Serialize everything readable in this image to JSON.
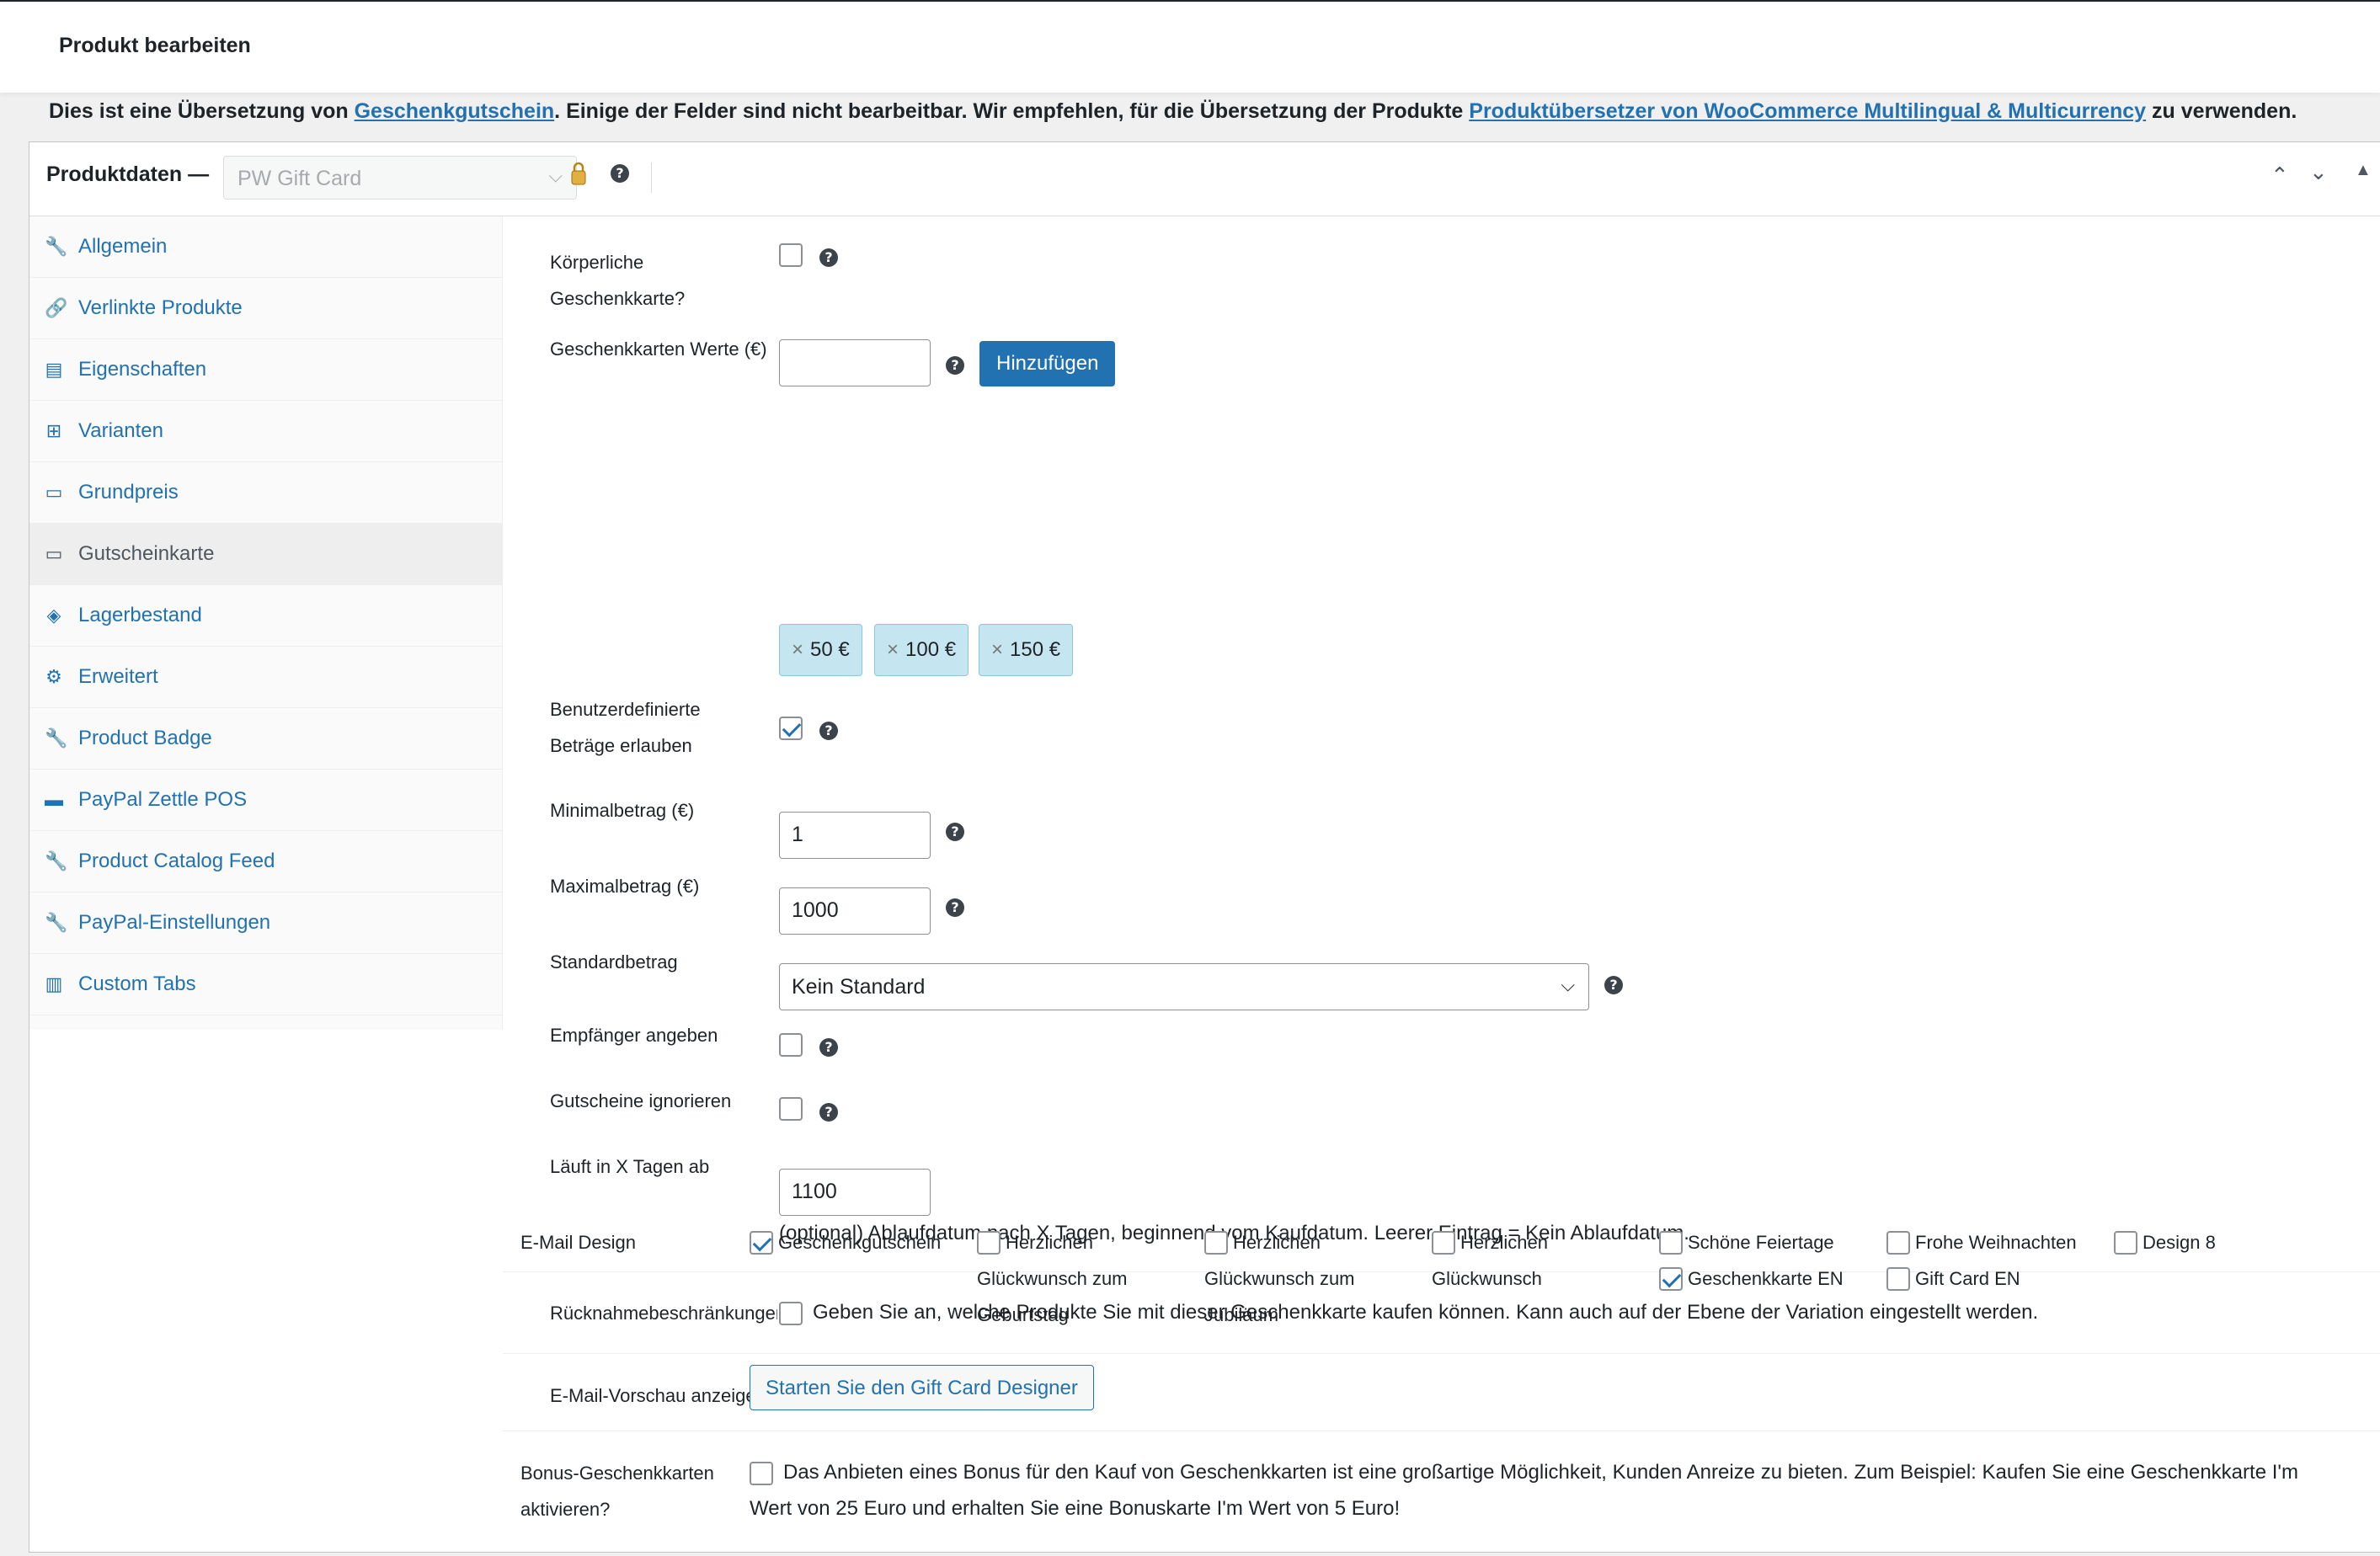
{
  "header": {
    "title": "Produkt bearbeiten"
  },
  "notice": {
    "text1": "Dies ist eine Übersetzung von ",
    "link1": "Geschenkgutschein",
    "text2": ". Einige der Felder sind nicht bearbeitbar. Wir empfehlen, für die Übersetzung der Produkte ",
    "link2": "Produktübersetzer von WooCommerce Multilingual & Multicurrency",
    "text3": " zu verwenden."
  },
  "product_data": {
    "label": "Produktdaten —",
    "type_value": "PW Gift Card"
  },
  "tabs": [
    {
      "label": "Allgemein",
      "icon": "wrench-icon"
    },
    {
      "label": "Verlinkte Produkte",
      "icon": "link-icon"
    },
    {
      "label": "Eigenschaften",
      "icon": "list-icon"
    },
    {
      "label": "Varianten",
      "icon": "grid-icon"
    },
    {
      "label": "Grundpreis",
      "icon": "card-icon"
    },
    {
      "label": "Gutscheinkarte",
      "icon": "card-icon"
    },
    {
      "label": "Lagerbestand",
      "icon": "tag-icon"
    },
    {
      "label": "Erweitert",
      "icon": "gear-icon"
    },
    {
      "label": "Product Badge",
      "icon": "wrench-icon"
    },
    {
      "label": "PayPal Zettle POS",
      "icon": "pos-icon"
    },
    {
      "label": "Product Catalog Feed",
      "icon": "wrench-icon"
    },
    {
      "label": "PayPal-Einstellungen",
      "icon": "wrench-icon"
    },
    {
      "label": "Custom Tabs",
      "icon": "tabs-icon"
    }
  ],
  "form": {
    "physical_label1": "Körperliche",
    "physical_label2": "Geschenkkarte?",
    "values_label": "Geschenkkarten Werte (€)",
    "values_input": "",
    "add_button": "Hinzufügen",
    "chips": [
      "50 €",
      "100 €",
      "150 €"
    ],
    "custom_label1": "Benutzerdefinierte",
    "custom_label2": "Beträge erlauben",
    "min_label": "Minimalbetrag (€)",
    "min_value": "1",
    "max_label": "Maximalbetrag (€)",
    "max_value": "1000",
    "default_label": "Standardbetrag",
    "default_value": "Kein Standard",
    "recipient_label": "Empfänger angeben",
    "ignore_label": "Gutscheine ignorieren",
    "expiry_label": "Läuft in X Tagen ab",
    "expiry_value": "1100",
    "expiry_desc": "(optional) Ablaufdatum nach X Tagen, beginnend vom Kaufdatum. Leerer Eintrag = Kein Ablaufdatum.",
    "restrict_label": "Rücknahmebeschränkungen",
    "restrict_desc": "Geben Sie an, welche Produkte Sie mit dieser Geschenkkarte kaufen können. Kann auch auf der Ebene der Variation eingestellt werden.",
    "preview_label": "E-Mail-Vorschau anzeigen",
    "design_label": "E-Mail Design",
    "designs": {
      "d1": "Geschenkgutschein",
      "d2a": "Herzlichen",
      "d2b": "Glückwunsch zum",
      "d2c": "Geburtstag",
      "d3a": "Herzlichen",
      "d3b": "Glückwunsch zum",
      "d3c": "Jubiläum",
      "d4a": "Herzlichen",
      "d4b": "Glückwunsch",
      "d5": "Schöne Feiertage",
      "d6": "Frohe Weihnachten",
      "d7": "Design 8",
      "d8": "Geschenkkarte EN",
      "d9": "Gift Card EN"
    },
    "designer_button": "Starten Sie den Gift Card Designer",
    "bonus_label1": "Bonus-Geschenkkarten",
    "bonus_label2": "aktivieren?",
    "bonus_desc1": "Das Anbieten eines Bonus für den Kauf von Geschenkkarten ist eine großartige Möglichkeit, Kunden Anreize zu bieten. Zum Beispiel: Kaufen Sie eine Geschenkkarte I'm",
    "bonus_desc2": "Wert von 25 Euro und erhalten Sie eine Bonuskarte I'm Wert von 5 Euro!"
  },
  "colors": {
    "link": "#2271b1",
    "chip": "#c5e6f0"
  }
}
